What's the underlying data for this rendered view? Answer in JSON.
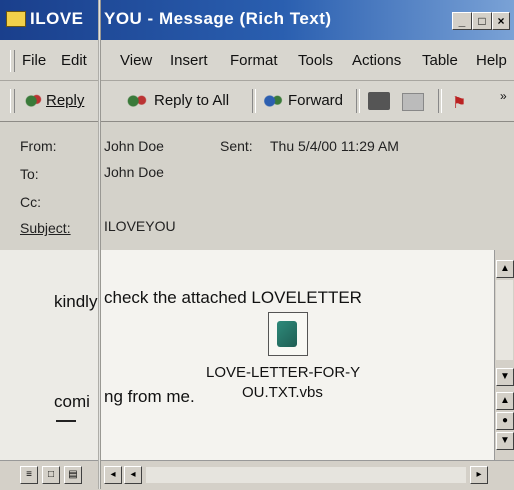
{
  "window": {
    "title_back": "ILOVE",
    "title_front": "YOU - Message (Rich Text)"
  },
  "menu": [
    "File",
    "Edit",
    "View",
    "Insert",
    "Format",
    "Tools",
    "Actions",
    "Table",
    "Help"
  ],
  "toolbar": {
    "reply": "Reply",
    "reply_all": "Reply to All",
    "forward": "Forward"
  },
  "header": {
    "from_label": "From:",
    "from_value": "John Doe",
    "sent_label": "Sent:",
    "sent_value": "Thu 5/4/00 11:29 AM",
    "to_label": "To:",
    "to_value": "John Doe",
    "cc_label": "Cc:",
    "subject_label": "Subject:",
    "subject_value": "ILOVEYOU"
  },
  "body": {
    "line1_a": "kindly",
    "line1_b": " check the attached LOVELETTER",
    "line2_a": "comi",
    "line2_b": "ng from me.",
    "attachment_line1": "LOVE-LETTER-FOR-Y",
    "attachment_line2": "OU.TXT.vbs"
  },
  "colors": {
    "titlebar": "#1a3f8c",
    "chrome": "#d4d0c8"
  }
}
